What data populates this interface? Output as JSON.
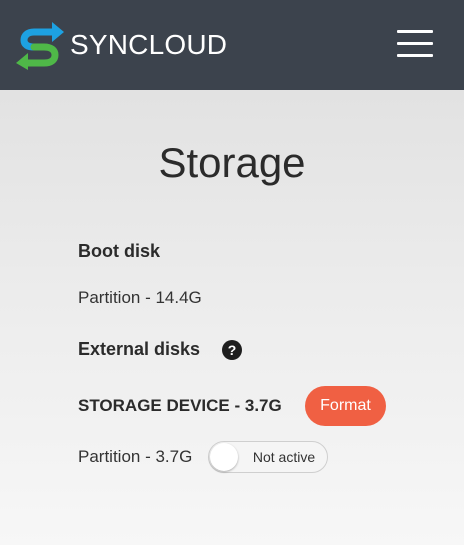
{
  "header": {
    "brand": "SYNCLOUD",
    "logo_icon": "syncloud-logo-icon",
    "menu_icon": "hamburger-menu-icon",
    "colors": {
      "background": "#3c434d",
      "logo_blue": "#1da1e2",
      "logo_green": "#4fb848"
    }
  },
  "page": {
    "title": "Storage"
  },
  "boot_disk": {
    "title": "Boot disk",
    "partition": "Partition - 14.4G"
  },
  "external_disks": {
    "title": "External disks",
    "help_icon": "question-circle-icon",
    "help_glyph": "?",
    "devices": [
      {
        "name": "STORAGE DEVICE - 3.7G",
        "format_label": "Format",
        "partitions": [
          {
            "label": "Partition - 3.7G",
            "toggle_label": "Not active",
            "active": false
          }
        ]
      }
    ]
  },
  "colors": {
    "accent": "#f06043"
  }
}
